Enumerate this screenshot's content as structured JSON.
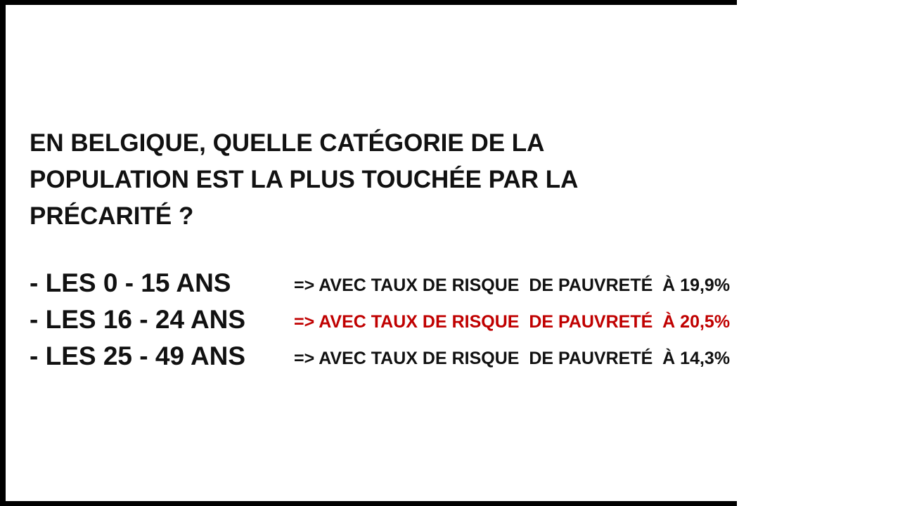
{
  "question": {
    "line1": "EN BELGIQUE, QUELLE CATÉGORIE DE LA",
    "line2": "POPULATION EST LA PLUS TOUCHÉE PAR LA",
    "line3": "PRÉCARITÉ ?"
  },
  "options": [
    {
      "label": "- LES 0 - 15 ANS",
      "answer": "=> AVEC TAUX DE RISQUE  DE PAUVRETÉ  À 19,9%",
      "highlighted": false
    },
    {
      "label": "- LES 16 - 24 ANS",
      "answer": "=> AVEC TAUX DE RISQUE  DE PAUVRETÉ  À 20,5%",
      "highlighted": true
    },
    {
      "label": "- LES 25 - 49 ANS",
      "answer": "=> AVEC TAUX DE RISQUE  DE PAUVRETÉ  À 14,3%",
      "highlighted": false
    }
  ],
  "colors": {
    "text": "#111111",
    "highlight": "#c00000",
    "frame": "#000000",
    "background": "#ffffff"
  }
}
